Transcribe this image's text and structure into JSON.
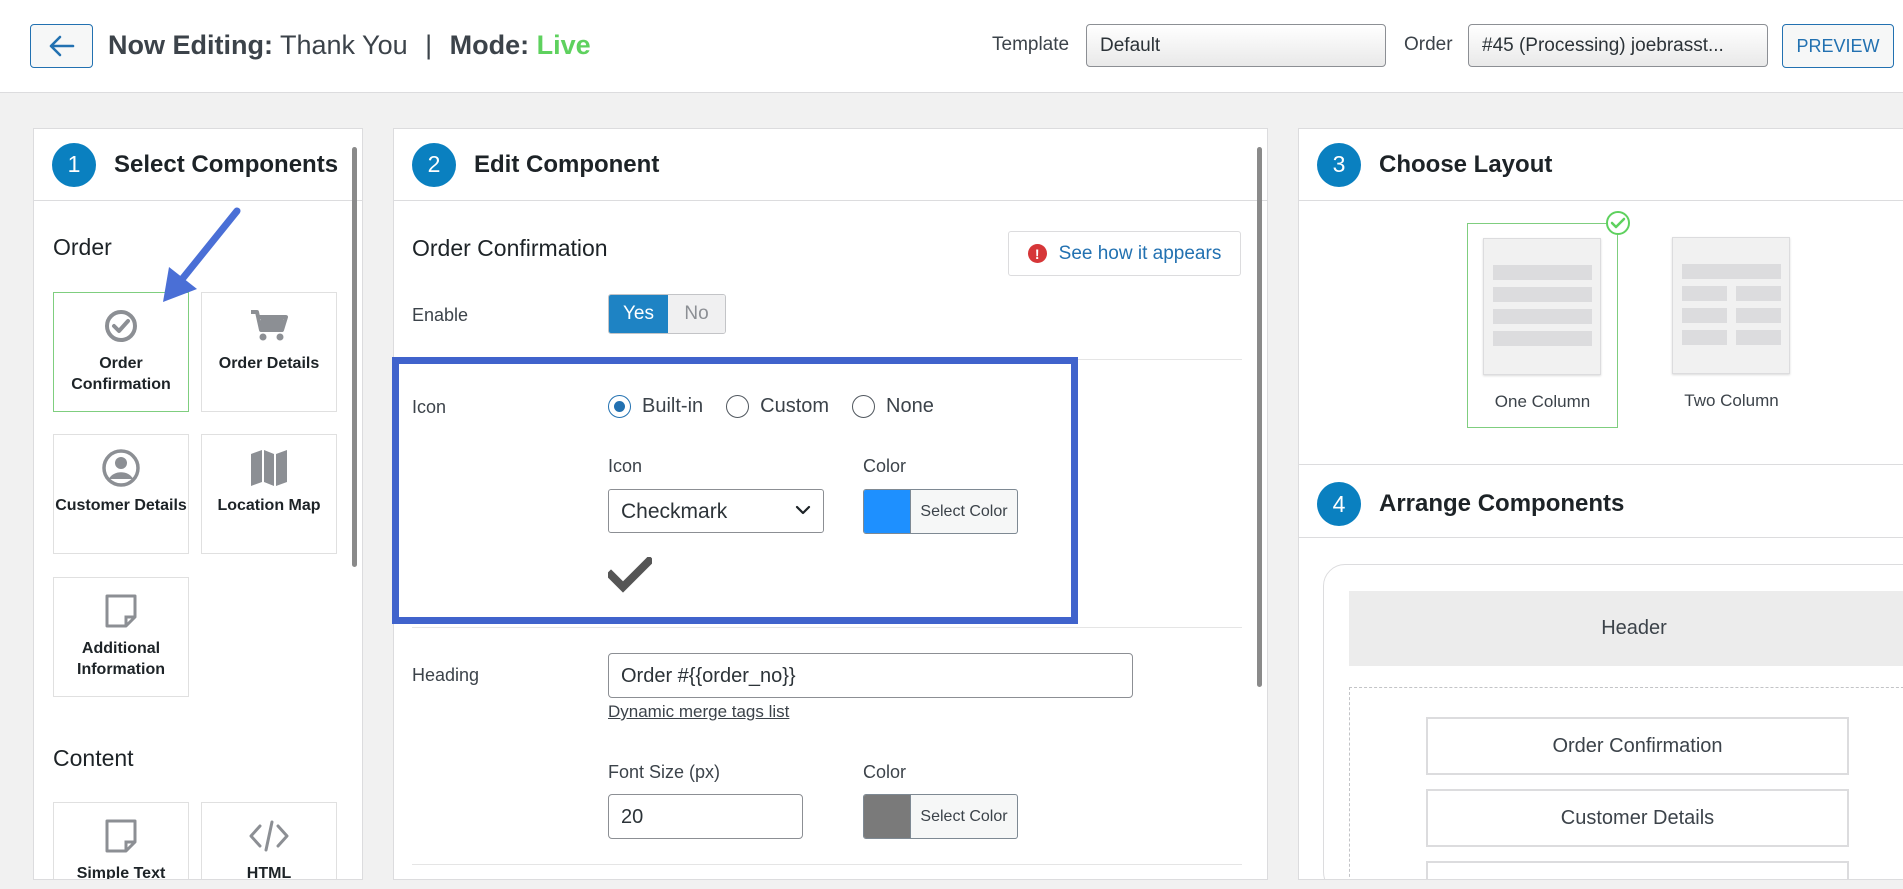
{
  "header": {
    "now_editing_label": "Now Editing:",
    "page_name": "Thank You",
    "separator": "|",
    "mode_label": "Mode:",
    "mode_value": "Live",
    "template_label": "Template",
    "template_value": "Default",
    "order_label": "Order",
    "order_value": "#45 (Processing) joebrasst...",
    "preview_label": "PREVIEW"
  },
  "select_components": {
    "step": "1",
    "title": "Select Components",
    "order_section": "Order",
    "order_items": [
      {
        "label": "Order Confirmation",
        "icon": "check-circle-icon"
      },
      {
        "label": "Order Details",
        "icon": "cart-icon"
      },
      {
        "label": "Customer Details",
        "icon": "user-circle-icon"
      },
      {
        "label": "Location Map",
        "icon": "map-icon"
      },
      {
        "label": "Additional Information",
        "icon": "note-icon"
      }
    ],
    "content_section": "Content",
    "content_items": [
      {
        "label": "Simple Text",
        "icon": "note-icon"
      },
      {
        "label": "HTML",
        "icon": "code-icon"
      }
    ]
  },
  "edit_component": {
    "step": "2",
    "title": "Edit Component",
    "component_title": "Order Confirmation",
    "see_how_label": "See how it appears",
    "enable_label": "Enable",
    "enable_yes": "Yes",
    "enable_no": "No",
    "icon_label": "Icon",
    "icon_options": [
      "Built-in",
      "Custom",
      "None"
    ],
    "icon_selected": "Built-in",
    "icon_field_label": "Icon",
    "icon_value": "Checkmark",
    "icon_color_label": "Color",
    "icon_color": "#1e90ff",
    "select_color_label": "Select Color",
    "heading_label": "Heading",
    "heading_value": "Order #{{order_no}}",
    "merge_tags_link": "Dynamic merge tags list",
    "font_size_label": "Font Size (px)",
    "font_size_value": "20",
    "heading_color_label": "Color",
    "heading_color": "#7a7a7a"
  },
  "choose_layout": {
    "step": "3",
    "title": "Choose Layout",
    "options": [
      {
        "label": "One Column",
        "selected": true
      },
      {
        "label": "Two Column",
        "selected": false
      }
    ]
  },
  "arrange_components": {
    "step": "4",
    "title": "Arrange Components",
    "header_block": "Header",
    "items": [
      "Order Confirmation",
      "Customer Details"
    ]
  },
  "colors": {
    "accent": "#0a80c0",
    "live": "#5ed15e",
    "highlight": "#4063cc",
    "arrow": "#4a6fd6"
  }
}
